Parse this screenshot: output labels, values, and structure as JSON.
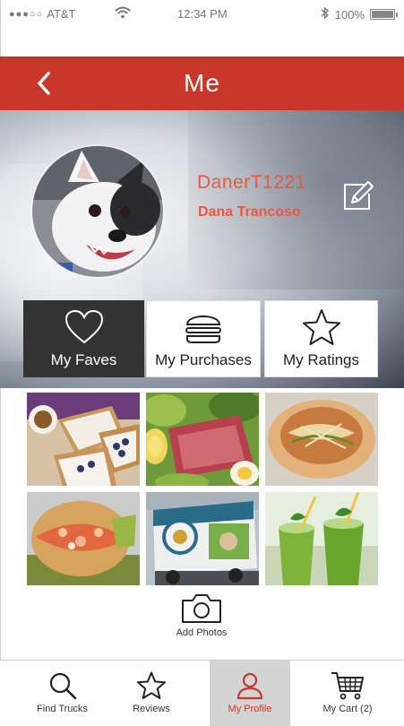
{
  "status_bar": {
    "carrier": "AT&T",
    "time": "12:34 PM",
    "battery": "100%",
    "battery_level": 1.0,
    "icons": [
      "wifi-icon",
      "bluetooth-icon",
      "battery-icon"
    ]
  },
  "header": {
    "title": "Me",
    "back_icon": "chevron-left-icon"
  },
  "profile": {
    "username": "DanerT1221",
    "full_name": "Dana Trancoso",
    "edit_icon": "edit-icon"
  },
  "tabs": [
    {
      "label": "My Faves",
      "icon": "heart-icon",
      "active": true
    },
    {
      "label": "My Purchases",
      "icon": "burger-icon",
      "active": false
    },
    {
      "label": "My Ratings",
      "icon": "star-icon",
      "active": false
    }
  ],
  "add_photos": {
    "label": "Add Photos",
    "icon": "camera-icon"
  },
  "bottom_nav": [
    {
      "label": "Find Trucks",
      "icon": "search-icon",
      "active": false
    },
    {
      "label": "Reviews",
      "icon": "star-icon",
      "active": false
    },
    {
      "label": "My Profile",
      "icon": "user-icon",
      "active": true
    },
    {
      "label": "My Cart (2)",
      "icon": "cart-icon",
      "active": false
    }
  ],
  "colors": {
    "brand_red": "#c8372a",
    "name_accent": "#e8593f",
    "active_tab": "#333333"
  }
}
